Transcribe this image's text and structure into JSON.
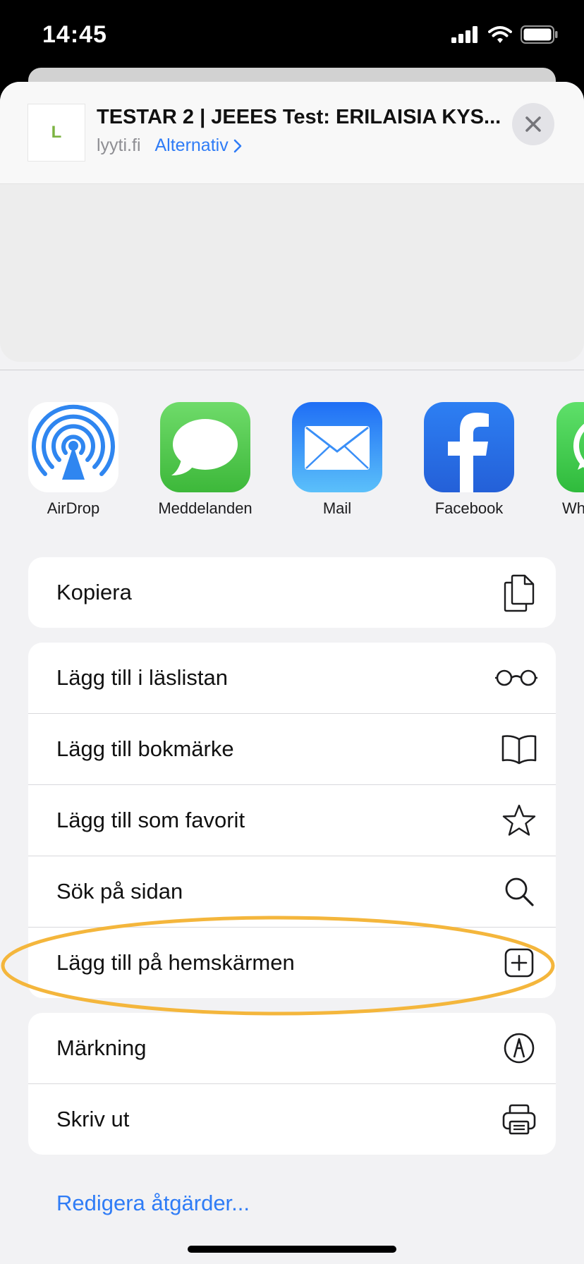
{
  "status_bar": {
    "time": "14:45"
  },
  "header": {
    "title": "TESTAR 2 | JEEES Test: ERILAISIA KYS...",
    "domain": "lyyti.fi",
    "options_label": "Alternativ",
    "thumb_letter": "L"
  },
  "apps": [
    {
      "label": "AirDrop",
      "icon": "airdrop-icon"
    },
    {
      "label": "Meddelanden",
      "icon": "messages-icon"
    },
    {
      "label": "Mail",
      "icon": "mail-icon"
    },
    {
      "label": "Facebook",
      "icon": "facebook-icon"
    },
    {
      "label": "Wh",
      "icon": "whatsapp-icon"
    }
  ],
  "actions": {
    "copy": {
      "label": "Kopiera",
      "icon": "copy-icon"
    },
    "reading_list": {
      "label": "Lägg till i läslistan",
      "icon": "glasses-icon"
    },
    "bookmark": {
      "label": "Lägg till bokmärke",
      "icon": "book-icon"
    },
    "favorite": {
      "label": "Lägg till som favorit",
      "icon": "star-icon"
    },
    "find": {
      "label": "Sök på sidan",
      "icon": "search-icon"
    },
    "home_screen": {
      "label": "Lägg till på hemskärmen",
      "icon": "plus-square-icon"
    },
    "markup": {
      "label": "Märkning",
      "icon": "markup-icon"
    },
    "print": {
      "label": "Skriv ut",
      "icon": "printer-icon"
    }
  },
  "edit_actions_label": "Redigera åtgärder...",
  "colors": {
    "accent": "#2f7cf6",
    "highlight": "#f4b63c",
    "sheet_bg": "#f2f2f4"
  }
}
